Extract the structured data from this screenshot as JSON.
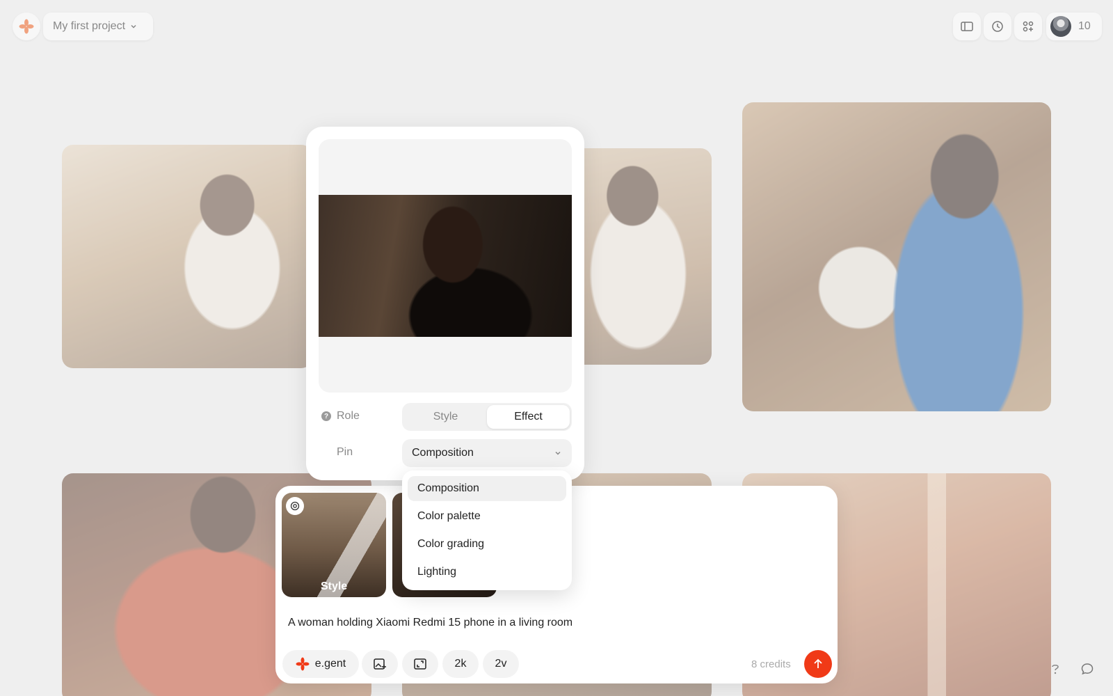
{
  "header": {
    "project_name": "My first project",
    "credits_count": "10",
    "icons": [
      "logo-flower-icon",
      "sidebar-toggle-icon",
      "history-icon",
      "apps-grid-icon"
    ]
  },
  "reference_popover": {
    "role_label": "Role",
    "role_options": [
      "Style",
      "Effect"
    ],
    "role_selected": "Effect",
    "pin_label": "Pin",
    "pin_value": "Composition"
  },
  "pin_dropdown": {
    "options": [
      "Composition",
      "Color palette",
      "Color grading",
      "Lighting"
    ],
    "highlighted": "Composition"
  },
  "prompt": {
    "thumbnails": [
      {
        "label": "Style"
      },
      {
        "label": ""
      }
    ],
    "text": "A woman holding Xiaomi Redmi 15 phone in a living room",
    "agent_label": "e.gent",
    "resolution": "2k",
    "variants": "2v",
    "cost": "8 credits"
  },
  "colors": {
    "accent": "#f03a17",
    "background": "#efefef"
  }
}
